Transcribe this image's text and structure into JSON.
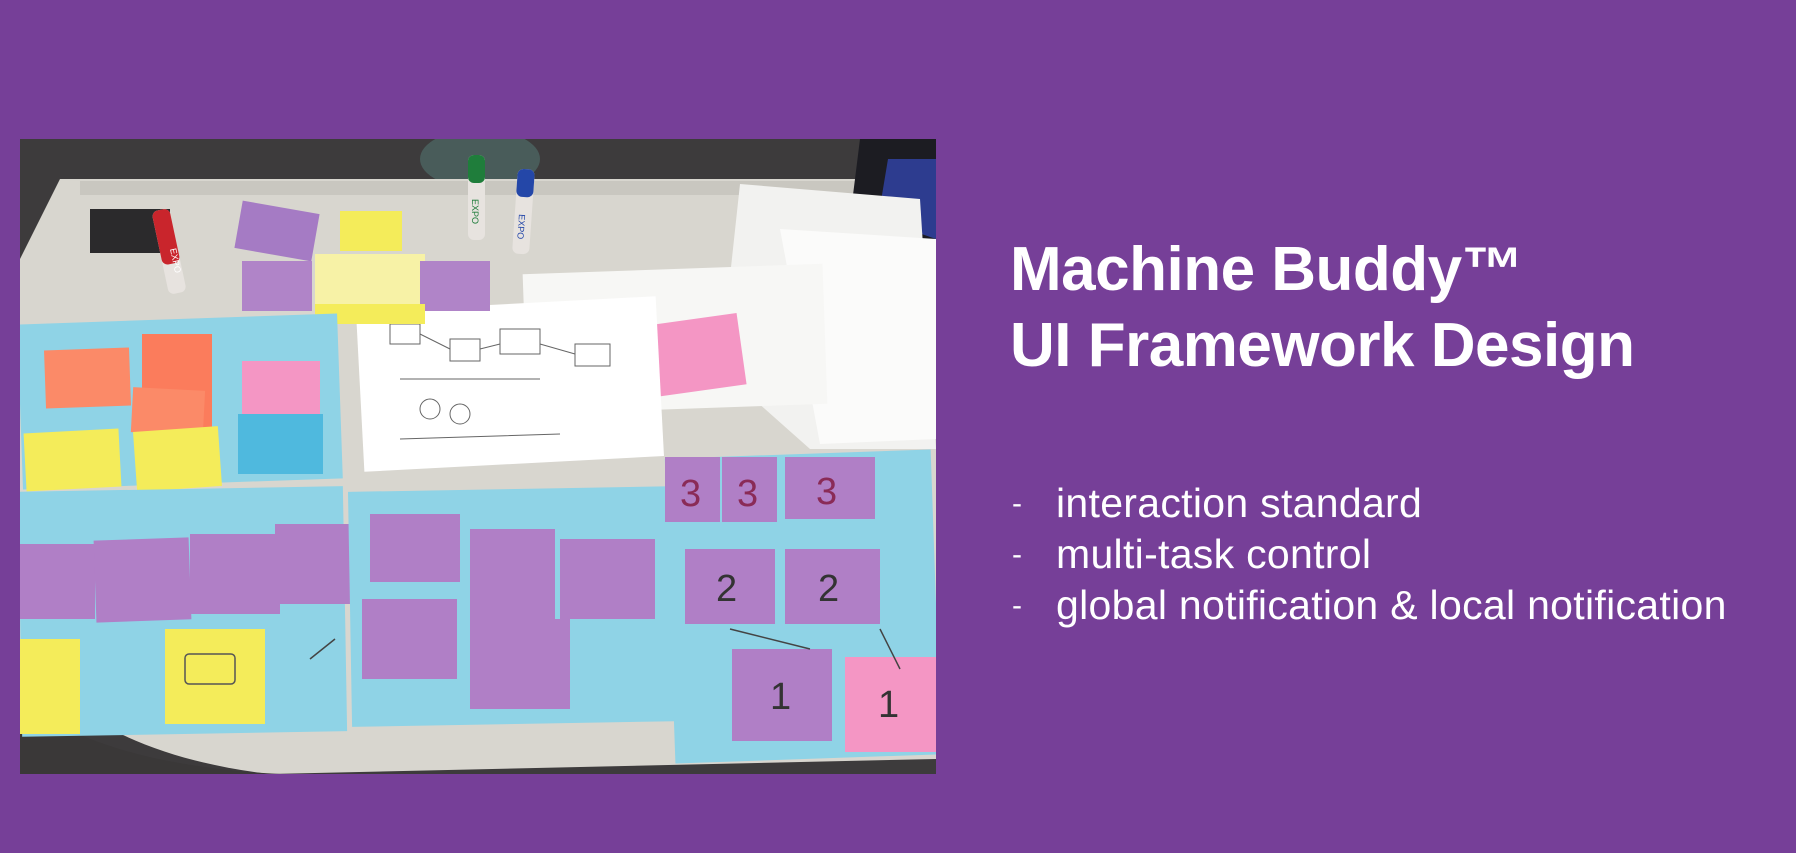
{
  "slide": {
    "title_lines": [
      "Machine Buddy™",
      "UI Framework Design"
    ],
    "bullet_marker": "-",
    "bullets": [
      "interaction standard",
      "multi-task control",
      "global notification & local notification"
    ],
    "background_color": "#763f98",
    "text_color": "#ffffff"
  },
  "photo": {
    "marker_labels": [
      "EXPO",
      "EXPO",
      "EXPO"
    ],
    "card_numbers": [
      "3",
      "3",
      "3",
      "2",
      "2",
      "1",
      "1"
    ],
    "colors": {
      "blue_sheet": "#8fd3e6",
      "purple_note": "#b07fc6",
      "yellow_note": "#f4ec5a",
      "orange_note": "#fb8a68",
      "pink_note": "#f496c4",
      "table": "#d8d6cf"
    }
  }
}
